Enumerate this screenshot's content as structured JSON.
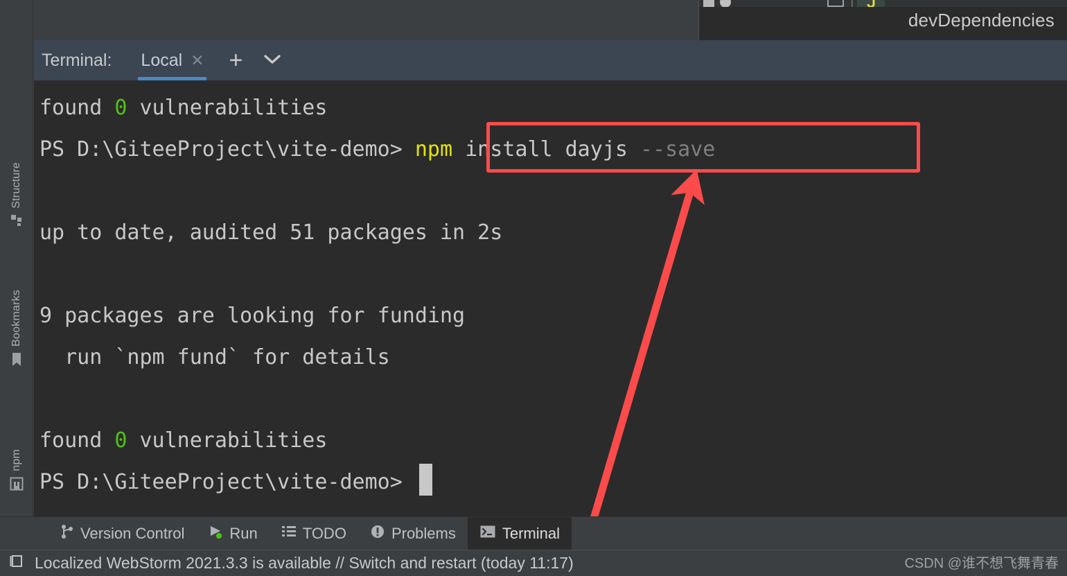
{
  "editor": {
    "right_pane_label": "devDependencies"
  },
  "terminal_header": {
    "title": "Terminal:",
    "tab_label": "Local",
    "close_icon": "close-icon",
    "add_icon": "plus-icon",
    "dropdown_icon": "chevron-down-icon"
  },
  "left_strip": {
    "items": [
      {
        "label": "Structure",
        "icon": "structure-icon"
      },
      {
        "label": "Bookmarks",
        "icon": "bookmark-icon"
      },
      {
        "label": "npm",
        "icon": "npm-icon"
      }
    ]
  },
  "terminal": {
    "lines": [
      {
        "segments": [
          {
            "text": "found ",
            "color": "normal"
          },
          {
            "text": "0",
            "color": "green"
          },
          {
            "text": " vulnerabilities",
            "color": "normal"
          }
        ]
      },
      {
        "segments": [
          {
            "text": "PS D:\\GiteeProject\\vite-demo> ",
            "color": "normal"
          },
          {
            "text": "npm",
            "color": "yellow"
          },
          {
            "text": " install dayjs ",
            "color": "normal"
          },
          {
            "text": "--save",
            "color": "dim"
          }
        ]
      },
      {
        "segments": []
      },
      {
        "segments": [
          {
            "text": "up to date, audited 51 packages in 2s",
            "color": "normal"
          }
        ]
      },
      {
        "segments": []
      },
      {
        "segments": [
          {
            "text": "9 packages are looking for funding",
            "color": "normal"
          }
        ]
      },
      {
        "segments": [
          {
            "text": "  run `npm fund` for details",
            "color": "normal"
          }
        ]
      },
      {
        "segments": []
      },
      {
        "segments": [
          {
            "text": "found ",
            "color": "normal"
          },
          {
            "text": "0",
            "color": "green"
          },
          {
            "text": " vulnerabilities",
            "color": "normal"
          }
        ]
      },
      {
        "segments": [
          {
            "text": "PS D:\\GiteeProject\\vite-demo> ",
            "color": "normal"
          }
        ],
        "cursor": true
      }
    ],
    "prompt": "PS D:\\GiteeProject\\vite-demo>",
    "typed_command": "npm install dayjs --save"
  },
  "annotation": {
    "highlight_color": "#fb4b4b",
    "arrow_color": "#fb4b4b",
    "highlighted_text": "npm install dayjs --save"
  },
  "bottom_bar": {
    "buttons": [
      {
        "label": "Version Control",
        "icon": "branch-icon",
        "active": false
      },
      {
        "label": "Run",
        "icon": "run-icon",
        "active": false
      },
      {
        "label": "TODO",
        "icon": "list-icon",
        "active": false
      },
      {
        "label": "Problems",
        "icon": "warning-icon",
        "active": false
      },
      {
        "label": "Terminal",
        "icon": "terminal-icon",
        "active": true
      }
    ]
  },
  "status_bar": {
    "icon": "notification-icon",
    "message": "Localized WebStorm 2021.3.3 is available // Switch and restart (today 11:17)"
  },
  "watermark": {
    "text": "CSDN @谁不想飞舞青春"
  },
  "colors": {
    "terminal_bg": "#2b2b2b",
    "panel_bg": "#3c3f41",
    "header_bg": "#3c4552",
    "tab_underline": "#4a88c7",
    "green": "#4fc414",
    "yellow": "#e5e500",
    "dim": "#7f7f7f"
  }
}
